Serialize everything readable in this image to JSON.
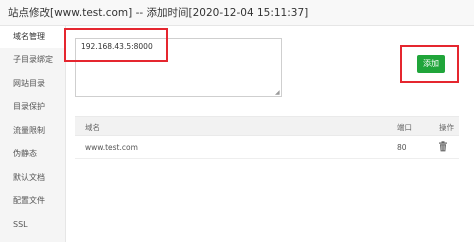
{
  "window": {
    "title": "站点修改[www.test.com] -- 添加时间[2020-12-04 15:11:37]"
  },
  "sidebar": {
    "items": [
      {
        "label": "域名管理",
        "active": true
      },
      {
        "label": "子目录绑定",
        "active": false
      },
      {
        "label": "网站目录",
        "active": false
      },
      {
        "label": "目录保护",
        "active": false
      },
      {
        "label": "流量限制",
        "active": false
      },
      {
        "label": "伪静态",
        "active": false
      },
      {
        "label": "默认文档",
        "active": false
      },
      {
        "label": "配置文件",
        "active": false
      },
      {
        "label": "SSL",
        "active": false
      }
    ]
  },
  "form": {
    "domain_value": "192.168.43.5:8000",
    "add_label": "添加"
  },
  "table": {
    "headers": [
      "域名",
      "端口",
      "操作"
    ],
    "rows": [
      {
        "domain": "www.test.com",
        "port": "80",
        "action_icon": "trash-icon"
      }
    ]
  },
  "colors": {
    "accent_green": "#20a53a",
    "highlight_red": "#e5262f"
  }
}
